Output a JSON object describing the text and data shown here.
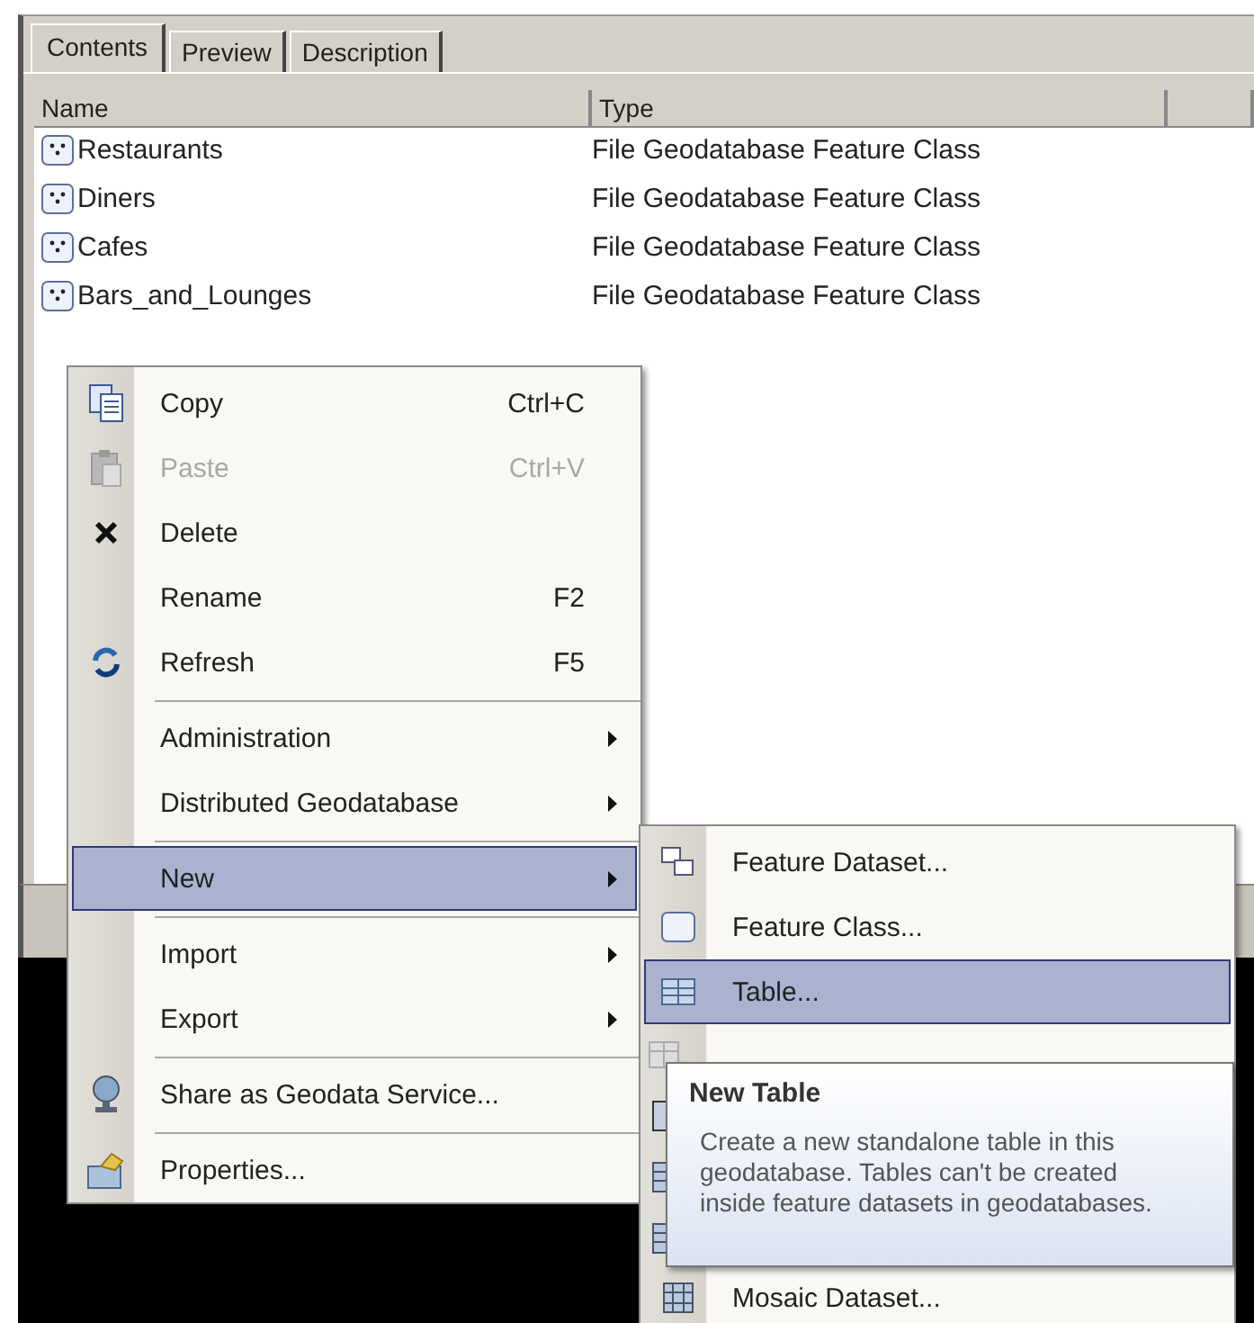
{
  "tabs": [
    {
      "label": "Contents",
      "selected": true
    },
    {
      "label": "Preview",
      "selected": false
    },
    {
      "label": "Description",
      "selected": false
    }
  ],
  "table": {
    "columns": [
      "Name",
      "Type"
    ],
    "rows": [
      {
        "name": "Restaurants",
        "type": "File Geodatabase Feature Class"
      },
      {
        "name": "Diners",
        "type": "File Geodatabase Feature Class"
      },
      {
        "name": "Cafes",
        "type": "File Geodatabase Feature Class"
      },
      {
        "name": "Bars_and_Lounges",
        "type": "File Geodatabase Feature Class"
      }
    ]
  },
  "context_menu": {
    "items": [
      {
        "kind": "item",
        "label": "Copy",
        "shortcut": "Ctrl+C",
        "disabled": false,
        "selected": false,
        "submenu": false
      },
      {
        "kind": "item",
        "label": "Paste",
        "shortcut": "Ctrl+V",
        "disabled": true,
        "selected": false,
        "submenu": false
      },
      {
        "kind": "item",
        "label": "Delete",
        "disabled": false,
        "selected": false,
        "submenu": false
      },
      {
        "kind": "item",
        "label": "Rename",
        "shortcut": "F2",
        "disabled": false,
        "selected": false,
        "submenu": false
      },
      {
        "kind": "item",
        "label": "Refresh",
        "shortcut": "F5",
        "disabled": false,
        "selected": false,
        "submenu": false
      },
      {
        "kind": "separator"
      },
      {
        "kind": "item",
        "label": "Administration",
        "disabled": false,
        "selected": false,
        "submenu": true
      },
      {
        "kind": "item",
        "label": "Distributed Geodatabase",
        "disabled": false,
        "selected": false,
        "submenu": true
      },
      {
        "kind": "separator"
      },
      {
        "kind": "item",
        "label": "New",
        "disabled": false,
        "selected": true,
        "submenu": true
      },
      {
        "kind": "separator"
      },
      {
        "kind": "item",
        "label": "Import",
        "disabled": false,
        "selected": false,
        "submenu": true
      },
      {
        "kind": "item",
        "label": "Export",
        "disabled": false,
        "selected": false,
        "submenu": true
      },
      {
        "kind": "separator"
      },
      {
        "kind": "item",
        "label": "Share as Geodata Service...",
        "disabled": false,
        "selected": false,
        "submenu": false
      },
      {
        "kind": "separator"
      },
      {
        "kind": "item",
        "label": "Properties...",
        "disabled": false,
        "selected": false,
        "submenu": false
      }
    ]
  },
  "submenu": {
    "items": [
      {
        "label": "Feature Dataset...",
        "selected": false
      },
      {
        "label": "Feature Class...",
        "selected": false
      },
      {
        "label": "Table...",
        "selected": true
      },
      {
        "kind": "covered"
      },
      {
        "kind": "covered"
      },
      {
        "kind": "covered"
      },
      {
        "kind": "covered"
      },
      {
        "label": "Mosaic Dataset...",
        "selected": false
      }
    ]
  },
  "tooltip": {
    "title": "New Table",
    "text": "Create a new standalone table in this geodatabase. Tables can't be created inside feature datasets in geodatabases."
  }
}
